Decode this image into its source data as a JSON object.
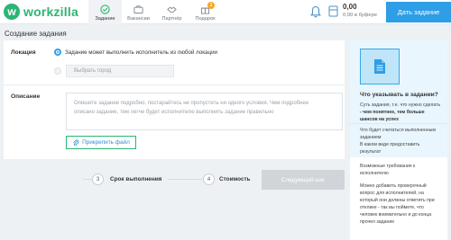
{
  "app": {
    "logo_letter": "w",
    "brand": "workzilla"
  },
  "nav": {
    "items": [
      {
        "label": "Задание",
        "icon": "check-circle-icon",
        "active": true
      },
      {
        "label": "Вакансии",
        "icon": "briefcase-icon",
        "active": false
      },
      {
        "label": "Партнёр",
        "icon": "handshake-icon",
        "active": false
      },
      {
        "label": "Подарок",
        "icon": "gift-icon",
        "active": false,
        "badge": "1"
      }
    ]
  },
  "account": {
    "balance": "0,00",
    "buffer_amount": "0,00",
    "buffer_label": "в буфере"
  },
  "cta_label": "Дать задание",
  "page_title": "Создание задания",
  "form": {
    "location_label": "Локация",
    "location_option_remote": "Задание может выполнить исполнитель из любой локации",
    "city_placeholder": "Выбрать город",
    "description_label": "Описание",
    "description_placeholder_line1": "Опишите задание подробно, постарайтесь не пропустить ни одного условия. Чем подробнее",
    "description_placeholder_line2": "описано задание, тем легче будет исполнителю выполнить задание правильно",
    "attach_label": "Прикрепить файл"
  },
  "steps": [
    {
      "num": "3",
      "label": "Срок выполнения"
    },
    {
      "num": "4",
      "label": "Стоимость"
    }
  ],
  "next_label": "Следующий шаг",
  "help": {
    "title": "Что указывать в задании?",
    "p1_pre": "Суть задания, т.е. что нужно сделать",
    "p1_bold": " - чем понятнее, тем больше шансов на успех",
    "p2": "Что будет считаться выполненным заданием",
    "p3": "В каком виде предоставить результат",
    "p4": "Возможные требования к исполнителю",
    "p5": "Можно добавить проверочный вопрос для исполнителей, на который они должны ответить при отклике - так вы поймете, что человек внимательно и до конца прочел задание"
  },
  "colors": {
    "brand_green": "#2bb573",
    "accent_blue": "#2e9ee6",
    "badge_orange": "#f5a623",
    "help_bg": "#e9f6fd"
  }
}
